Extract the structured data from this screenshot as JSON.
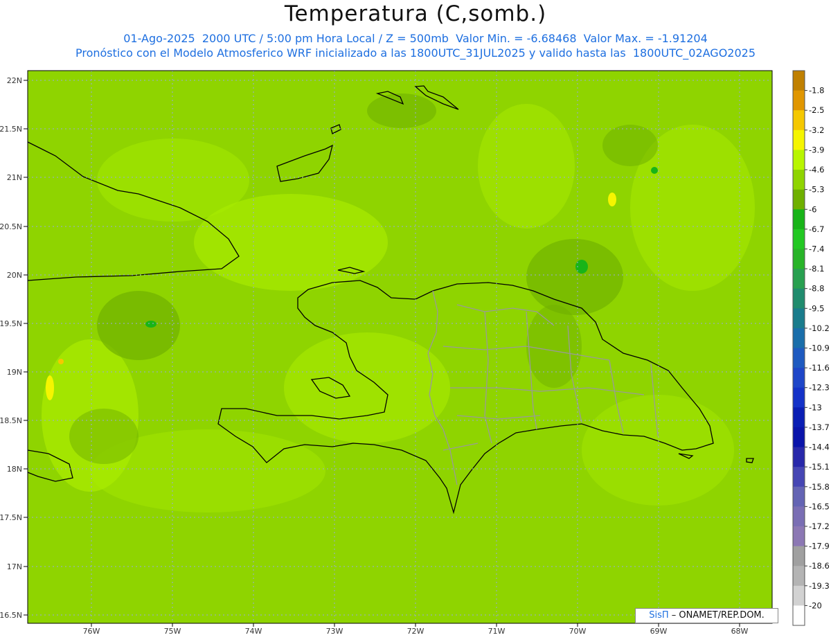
{
  "title": "Temperatura (C,somb.)",
  "subtitle1": "01-Ago-2025  2000 UTC / 5:00 pm Hora Local / Z = 500mb  Valor Min. = -6.68468  Valor Max. = -1.91204",
  "subtitle2": "Pronóstico con el Modelo Atmosferico WRF inicializado a las 1800UTC_31JUL2025 y valido hasta las  1800UTC_02AGO2025",
  "brand": {
    "logo_text": "SisΠ",
    "org_text": "– ONAMET/REP.DOM."
  },
  "map": {
    "lat_labels": [
      "22N",
      "21.5N",
      "21N",
      "20.5N",
      "20N",
      "19.5N",
      "19N",
      "18.5N",
      "18N",
      "17.5N",
      "17N",
      "16.5N"
    ],
    "lon_labels": [
      "76W",
      "75W",
      "74W",
      "73W",
      "72W",
      "71W",
      "70W",
      "69W",
      "68W"
    ],
    "background_color": "#8fd400"
  },
  "colorbar": {
    "labels": [
      "-1.8",
      "-2.5",
      "-3.2",
      "-3.9",
      "-4.6",
      "-5.3",
      "-6",
      "-6.7",
      "-7.4",
      "-8.1",
      "-8.8",
      "-9.5",
      "-10.2",
      "-10.9",
      "-11.6",
      "-12.3",
      "-13",
      "-13.7",
      "-14.4",
      "-15.1",
      "-15.8",
      "-16.5",
      "-17.2",
      "-17.9",
      "-18.6",
      "-19.3",
      "-20"
    ],
    "colors": [
      "#c08000",
      "#e09600",
      "#f5c800",
      "#f5f500",
      "#b8f500",
      "#8fd400",
      "#6fb000",
      "#18b418",
      "#22c822",
      "#28b428",
      "#28a050",
      "#208c6e",
      "#1a7c8c",
      "#1a6eaa",
      "#1e5ac0",
      "#1e46c8",
      "#1432c8",
      "#0a1eb4",
      "#0a14aa",
      "#2828aa",
      "#4646b4",
      "#6464b4",
      "#7a6eb4",
      "#8c78b4",
      "#a0a0a0",
      "#b4b4b4",
      "#d2d2d2",
      "#ffffff"
    ]
  }
}
